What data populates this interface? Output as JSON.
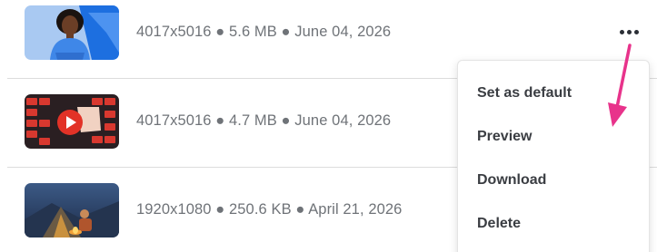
{
  "assets": [
    {
      "meta": "4017x5016 ● 5.6 MB ● June 04, 2026",
      "thumb_icon": "person-portrait-thumbnail"
    },
    {
      "meta": "4017x5016 ● 4.7 MB ● June 04, 2026",
      "thumb_icon": "video-play-thumbnail"
    },
    {
      "meta": "1920x1080 ● 250.6 KB ● April 21, 2026",
      "thumb_icon": "campfire-scene-thumbnail"
    }
  ],
  "menu": {
    "items": [
      "Set as default",
      "Preview",
      "Download",
      "Delete"
    ]
  },
  "colors": {
    "annotation_arrow": "#e8338b",
    "menu_text": "#3a3d42",
    "meta_text": "#6f7378"
  }
}
